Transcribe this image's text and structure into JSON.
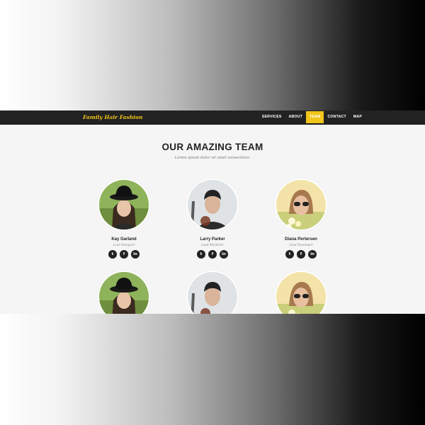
{
  "brand": "Family Hair Fashion",
  "nav": {
    "items": [
      {
        "label": "SERVICES"
      },
      {
        "label": "ABOUT"
      },
      {
        "label": "TEAM"
      },
      {
        "label": "CONTACT"
      },
      {
        "label": "MAP"
      }
    ],
    "active": "TEAM"
  },
  "team": {
    "title": "OUR AMAZING TEAM",
    "subtitle": "Lorem ipsum dolor sit amet consectetur.",
    "members": [
      {
        "name": "Kay Garland",
        "role": "Lead Designer"
      },
      {
        "name": "Larry Parker",
        "role": "Lead Marketer"
      },
      {
        "name": "Diana Pertersen",
        "role": "Lead Developer"
      }
    ],
    "social_icons": [
      "twitter-icon",
      "facebook-icon",
      "linkedin-icon"
    ],
    "social_glyphs": {
      "twitter": "t",
      "facebook": "f",
      "linkedin": "in"
    }
  },
  "colors": {
    "accent": "#f0c419",
    "navbar": "#222222",
    "page_bg": "#f5f5f5"
  }
}
